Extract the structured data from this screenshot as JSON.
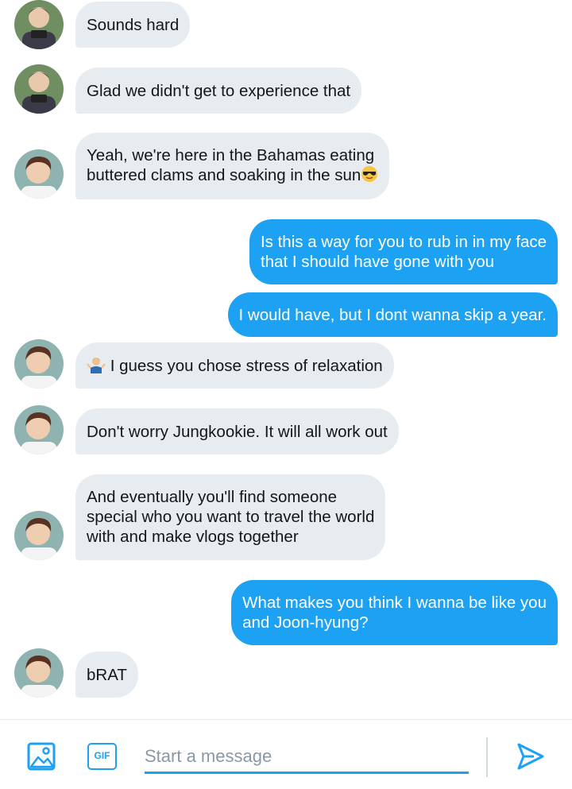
{
  "conversation": {
    "messages": [
      {
        "sender": "other",
        "avatar": "avatar-namjoon",
        "text": "Sounds hard"
      },
      {
        "sender": "other",
        "avatar": "avatar-namjoon",
        "text": "Glad we didn't get to experience that"
      },
      {
        "sender": "other",
        "avatar": "avatar-jin",
        "text": "Yeah, we're here in the Bahamas eating\nbuttered clams and soaking in the sun",
        "emoji": "sunglasses-emoji"
      },
      {
        "sender": "me",
        "text": "Is this a way for you to rub in in my face\nthat I should have gone with you"
      },
      {
        "sender": "me",
        "text": "I would have, but I dont wanna skip a year."
      },
      {
        "sender": "other",
        "avatar": "avatar-jin",
        "text": "I guess you chose stress of relaxation",
        "emoji": "shrug-emoji"
      },
      {
        "sender": "other",
        "avatar": "avatar-jin",
        "text": "Don't worry Jungkookie. It will all work out"
      },
      {
        "sender": "other",
        "avatar": "avatar-jin",
        "text": "And eventually you'll find someone\nspecial who you want to travel the world\nwith and make vlogs together"
      },
      {
        "sender": "me",
        "text": "What makes you think I wanna be like you\nand Joon-hyung?"
      },
      {
        "sender": "other",
        "avatar": "avatar-jin",
        "text": "bRAT"
      }
    ]
  },
  "composer": {
    "placeholder": "Start a message",
    "gif_label": "GIF",
    "icons": [
      "image-icon",
      "gif-icon",
      "send-icon"
    ]
  },
  "colors": {
    "accent": "#1da1f2",
    "incoming_bubble": "#e6ecf0",
    "outgoing_text": "#ffffff",
    "text": "#14171a",
    "placeholder": "#8a98a6"
  }
}
